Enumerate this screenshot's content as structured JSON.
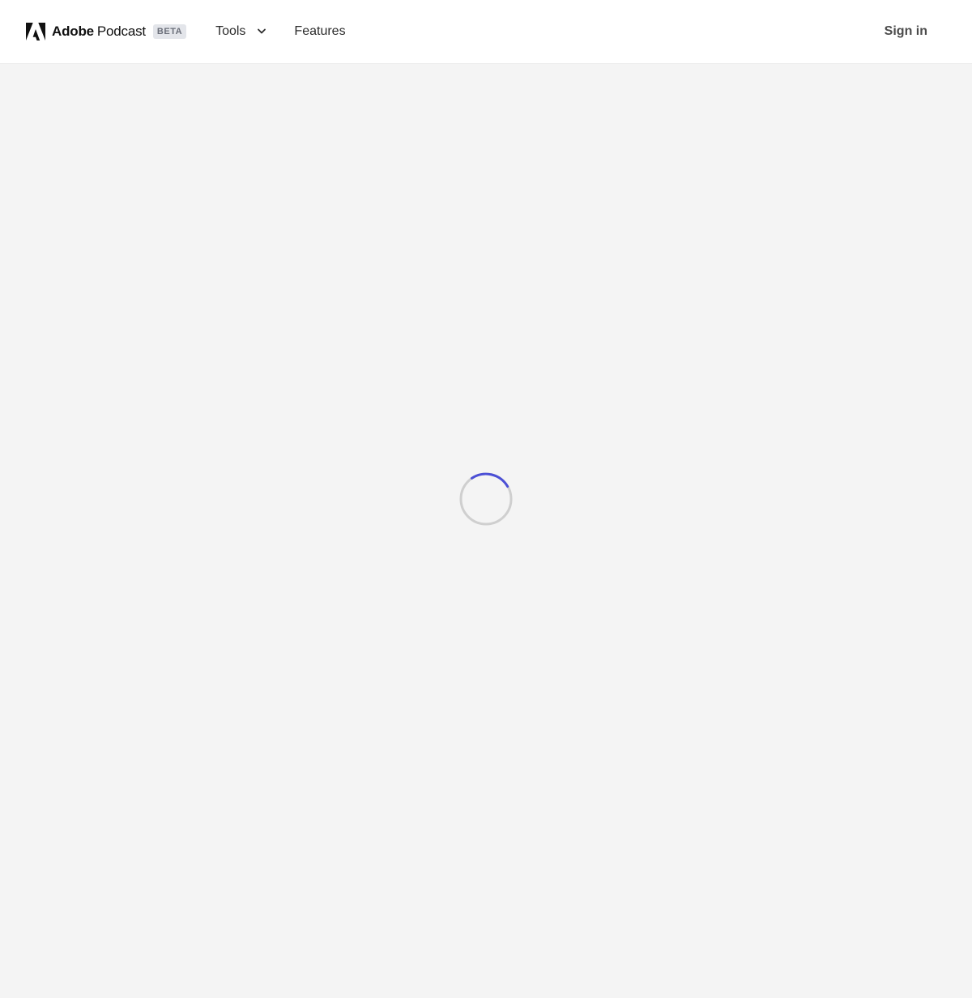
{
  "header": {
    "brand_bold": "Adobe",
    "brand_light": "Podcast",
    "badge": "BETA",
    "logo_icon": "adobe-logo-icon"
  },
  "nav": {
    "tools_label": "Tools",
    "tools_icon": "chevron-down-icon",
    "features_label": "Features"
  },
  "auth": {
    "sign_in_label": "Sign in"
  },
  "loading": {
    "spinner_icon": "loading-spinner-icon"
  },
  "colors": {
    "page_bg": "#f4f4f4",
    "header_bg": "#ffffff",
    "spinner_track": "#cfcfcf",
    "spinner_accent": "#4b4fd6",
    "badge_bg": "#e3e5ea"
  }
}
